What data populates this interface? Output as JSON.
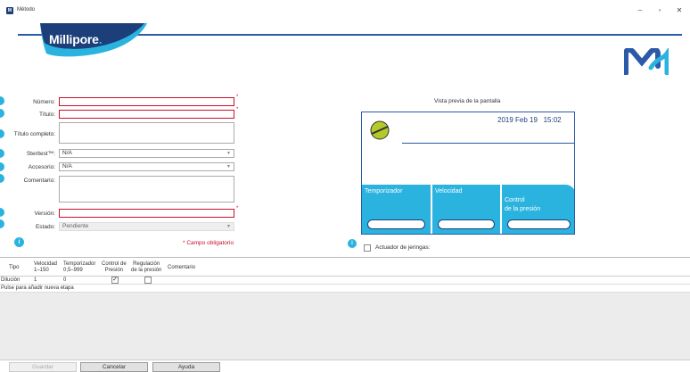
{
  "window": {
    "title": "Método",
    "minimize": "–",
    "maximize": "▫",
    "close": "✕"
  },
  "banner": {
    "brand": "Millipore",
    "brand_mark": "."
  },
  "form": {
    "numero": {
      "label": "Número:",
      "value": "",
      "required_mark": "*"
    },
    "titulo": {
      "label": "Título:",
      "value": "",
      "required_mark": "*"
    },
    "titulo_completo": {
      "label": "Título completo:",
      "value": ""
    },
    "steritest": {
      "label": "Steritest™:",
      "value": "N/A"
    },
    "accesorio": {
      "label": "Accesorio:",
      "value": "N/A"
    },
    "comentario": {
      "label": "Comentario:",
      "value": ""
    },
    "version": {
      "label": "Versión:",
      "value": "",
      "required_mark": "*"
    },
    "estado": {
      "label": "Estado:",
      "value": "Pendiente"
    },
    "required_note": "* Campo obligatorio"
  },
  "preview": {
    "title": "Vista previa de la pantalla",
    "date": "2019 Feb 19",
    "time": "15:02",
    "tiles": [
      "Temporizador",
      "Velocidad",
      "Control\nde la presión"
    ]
  },
  "syringe": {
    "label": "Actuador de jeringas:",
    "checked": false
  },
  "table": {
    "columns": [
      "Tipo",
      "Velocidad\n1–150",
      "Temporizador\n0,5–999",
      "Control de\nPresión",
      "Regulación\nde la presión",
      "Comentario"
    ],
    "rows": [
      {
        "tipo": "Dilución",
        "velocidad": "1",
        "temporizador": "0",
        "control": true,
        "regulacion": false,
        "comentario": ""
      }
    ],
    "add_step": "Pulse para añadir nueva etapa"
  },
  "buttons": {
    "guardar": "Guardar",
    "cancelar": "Cancelar",
    "ayuda": "Ayuda"
  },
  "colors": {
    "brand_blue": "#2a5aa8",
    "accent_cyan": "#2bb3e0",
    "required_red": "#c8102e"
  },
  "icons": [
    "app-icon",
    "minimize-icon",
    "maximize-icon",
    "close-icon",
    "info-icon",
    "chevron-down-icon",
    "checkbox"
  ]
}
